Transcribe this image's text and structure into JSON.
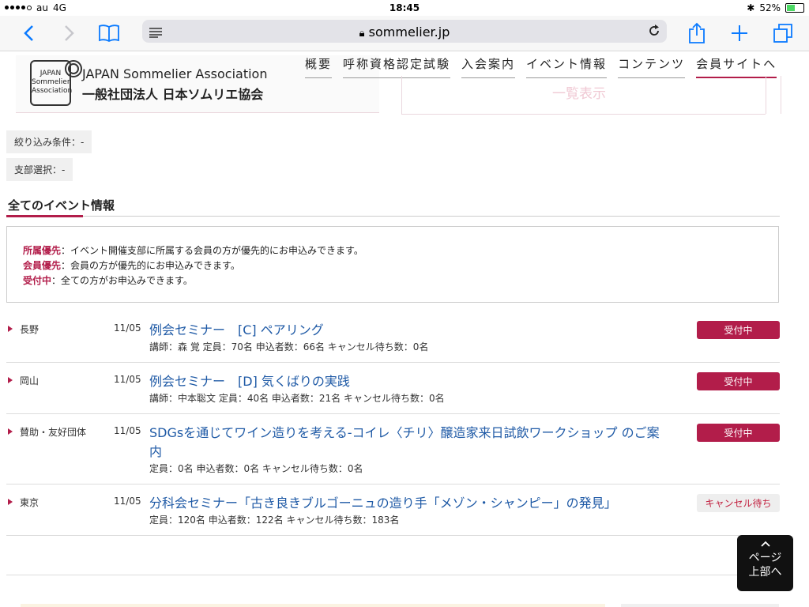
{
  "status": {
    "carrier": "au",
    "network": "4G",
    "time": "18:45",
    "battery": "52%"
  },
  "browser": {
    "url": "sommelier.jp",
    "icons": {
      "back": "chevron-left-icon",
      "forward": "chevron-right-icon",
      "bookmarks": "book-icon",
      "reader": "reader-icon",
      "reload": "reload-icon",
      "share": "share-icon",
      "new_tab": "plus-icon",
      "tabs": "tabs-icon"
    }
  },
  "site": {
    "logo_badge": [
      "JAPAN",
      "Sommelier",
      "Association"
    ],
    "logo_en": "JAPAN Sommelier Association",
    "logo_jp": "一般社団法人 日本ソムリエ協会",
    "nav": [
      "概要",
      "呼称資格認定試験",
      "入会案内",
      "イベント情報",
      "コンテンツ",
      "会員サイトへ"
    ],
    "tab_label": "一覧表示"
  },
  "filters": {
    "condition": "絞り込み条件：-",
    "branch": "支部選択：-"
  },
  "section_title": "全てのイベント情報",
  "legend": [
    {
      "key": "所属優先",
      "desc": "：イベント開催支部に所属する会員の方が優先的にお申込みできます。"
    },
    {
      "key": "会員優先",
      "desc": "：会員の方が優先的にお申込みできます。"
    },
    {
      "key": "受付中",
      "desc": "：全ての方がお申込みできます。"
    }
  ],
  "events": [
    {
      "region": "長野",
      "date": "11/05",
      "title": "例会セミナー　[C] ペアリング",
      "meta": "講師：森 覚 定員：70名 申込者数：66名 キャンセル待ち数：0名",
      "status": "受付中"
    },
    {
      "region": "岡山",
      "date": "11/05",
      "title": "例会セミナー　[D] 気くばりの実践",
      "meta": "講師：中本聡文 定員：40名 申込者数：21名 キャンセル待ち数：0名",
      "status": "受付中"
    },
    {
      "region": "賛助・友好団体",
      "date": "11/05",
      "title": "SDGsを通じてワイン造りを考える-コイレ〈チリ〉醸造家来日試飲ワークショップ のご案内",
      "meta": "定員：0名 申込者数：0名 キャンセル待ち数：0名",
      "status": "受付中"
    },
    {
      "region": "東京",
      "date": "11/05",
      "title": "分科会セミナー「古き良きブルゴーニュの造り手「メゾン・シャンピー」の発見」",
      "meta": "定員：120名 申込者数：122名 キャンセル待ち数：183名",
      "status": "キャンセル待ち"
    }
  ],
  "back_to_top": [
    "ページ",
    "上部へ"
  ],
  "colors": {
    "accent": "#b21d4a",
    "link": "#1f5aa6",
    "ios_blue": "#0a7aff"
  }
}
